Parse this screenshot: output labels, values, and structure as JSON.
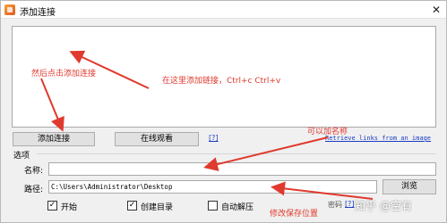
{
  "window": {
    "title": "添加连接",
    "close_glyph": "✕",
    "app_icon": "app-icon"
  },
  "buttons": {
    "add_link": "添加连接",
    "watch_online": "在线观看",
    "browse": "浏览"
  },
  "links": {
    "help1": "[?]",
    "retrieve": "Retrieve links from an image",
    "help2": "[?]"
  },
  "options": {
    "group_label": "选项",
    "name_label": "名称:",
    "name_value": "",
    "path_label": "路径:",
    "path_value": "C:\\Users\\Administrator\\Desktop",
    "partial_label": "密码"
  },
  "checkboxes": [
    {
      "label": "开始",
      "checked": true
    },
    {
      "label": "创建目录",
      "checked": true
    },
    {
      "label": "自动解压",
      "checked": false
    }
  ],
  "check_glyph": "✓",
  "annotations": {
    "then_click_add": "然后点击添加连接",
    "paste_here": "在这里添加链接，Ctrl+c Ctrl+v",
    "can_add_name": "可以加名称",
    "change_save_path": "修改保存位置"
  },
  "watermark": "知乎 @空有",
  "colors": {
    "annotation_red": "#e0392d",
    "link_blue": "#1a3cc6"
  }
}
